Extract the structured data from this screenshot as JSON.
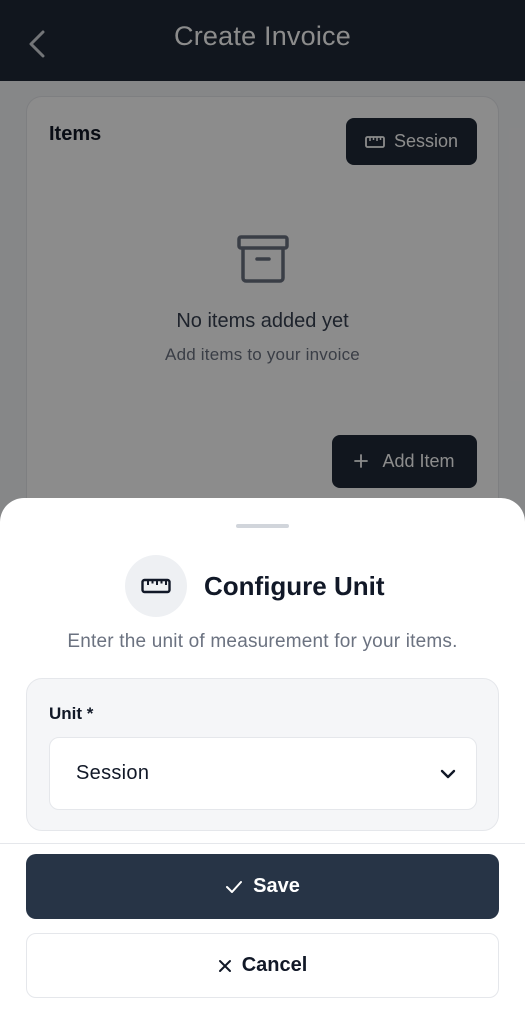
{
  "header": {
    "title": "Create Invoice",
    "back_icon": "chevron-left-icon"
  },
  "items_card": {
    "title": "Items",
    "unit_chip_label": "Session",
    "unit_chip_icon": "ruler-icon",
    "empty_icon": "archive-box-icon",
    "empty_title": "No items added yet",
    "empty_subtitle": "Add items to your invoice",
    "add_item_label": "Add Item",
    "add_item_icon": "plus-icon"
  },
  "sheet": {
    "icon": "ruler-icon",
    "title": "Configure Unit",
    "description": "Enter the unit of measurement for your items.",
    "unit_label": "Unit *",
    "unit_value": "Session",
    "dropdown_icon": "chevron-down-icon",
    "save_label": "Save",
    "save_icon": "check-icon",
    "cancel_label": "Cancel",
    "cancel_icon": "close-icon"
  },
  "colors": {
    "header_bg": "#1f2937",
    "primary_button": "#273446",
    "overlay": "rgba(0,0,0,0.45)"
  }
}
